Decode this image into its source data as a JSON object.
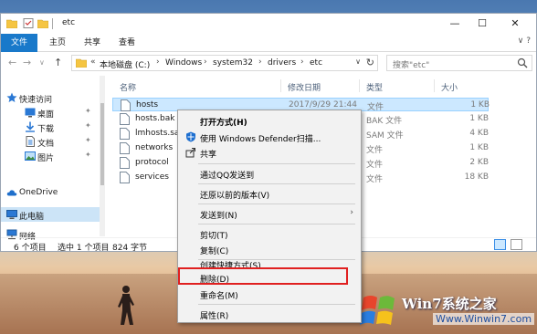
{
  "window": {
    "title": "etc",
    "min_glyph": "—",
    "max_glyph": "☐",
    "close_glyph": "✕"
  },
  "ribbon": {
    "tabs": [
      "文件",
      "主页",
      "共享",
      "查看"
    ],
    "help_glyph": "∨ ?"
  },
  "address": {
    "prefix": "«",
    "crumbs": [
      "本地磁盘 (C:)",
      "Windows",
      "system32",
      "drivers",
      "etc"
    ],
    "search_placeholder": "搜索\"etc\""
  },
  "nav_pane": {
    "items": [
      {
        "label": "快速访问",
        "icon": "star-icon"
      },
      {
        "label": "桌面",
        "icon": "desktop-icon",
        "pinned": true
      },
      {
        "label": "下载",
        "icon": "download-icon",
        "pinned": true
      },
      {
        "label": "文档",
        "icon": "document-icon",
        "pinned": true
      },
      {
        "label": "图片",
        "icon": "picture-icon",
        "pinned": true
      },
      {
        "label": "OneDrive",
        "icon": "cloud-icon"
      },
      {
        "label": "此电脑",
        "icon": "computer-icon"
      },
      {
        "label": "网络",
        "icon": "network-icon"
      }
    ]
  },
  "columns": [
    "名称",
    "修改日期",
    "类型",
    "大小"
  ],
  "files": [
    {
      "name": "hosts",
      "date": "2017/9/29 21:44",
      "type": "文件",
      "size": "1 KB"
    },
    {
      "name": "hosts.bak",
      "date": "",
      "type": "BAK 文件",
      "size": "1 KB"
    },
    {
      "name": "lmhosts.sam",
      "date": "",
      "type": "SAM 文件",
      "size": "4 KB"
    },
    {
      "name": "networks",
      "date": "",
      "type": "文件",
      "size": "1 KB"
    },
    {
      "name": "protocol",
      "date": "",
      "type": "文件",
      "size": "2 KB"
    },
    {
      "name": "services",
      "date": "",
      "type": "文件",
      "size": "18 KB"
    }
  ],
  "status": {
    "count": "6 个项目",
    "selected": "选中 1 个项目",
    "size": "824 字节"
  },
  "context_menu": {
    "items": [
      {
        "label": "打开方式(H)"
      },
      {
        "label": "使用 Windows Defender扫描...",
        "icon": "defender-shield-icon"
      },
      {
        "label": "共享",
        "icon": "share-icon"
      },
      {
        "label": "通过QQ发送到"
      },
      {
        "label": "还原以前的版本(V)"
      },
      {
        "label": "发送到(N)",
        "submenu": true
      },
      {
        "label": "剪切(T)"
      },
      {
        "label": "复制(C)"
      },
      {
        "label": "创建快捷方式(S)"
      },
      {
        "label": "删除(D)",
        "highlighted": true
      },
      {
        "label": "重命名(M)"
      },
      {
        "label": "属性(R)"
      }
    ],
    "arrow_glyph": "›",
    "highlight_color": "#e02020"
  },
  "watermark": {
    "brand": "Win7系统之家",
    "url": "Www.Winwin7.com"
  },
  "colors": {
    "accent": "#1979ca",
    "selection": "#cce8ff",
    "folder": "#f5c542"
  }
}
